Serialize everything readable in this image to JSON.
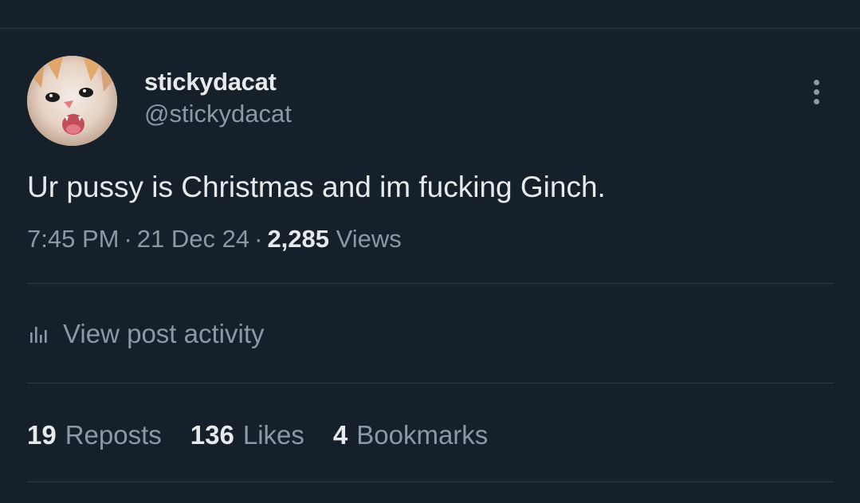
{
  "author": {
    "display_name": "stickydacat",
    "handle": "@stickydacat"
  },
  "post": {
    "text": "Ur pussy is Christmas and im fucking Ginch.",
    "time": "7:45 PM",
    "date": "21 Dec 24",
    "separator": "·",
    "views_count": "2,285",
    "views_label": "Views"
  },
  "activity": {
    "label": "View post activity",
    "icon": "bar-chart-icon"
  },
  "stats": [
    {
      "count": "19",
      "label": "Reposts"
    },
    {
      "count": "136",
      "label": "Likes"
    },
    {
      "count": "4",
      "label": "Bookmarks"
    }
  ],
  "icons": {
    "more": "more-vertical-icon",
    "avatar": "kitten-avatar"
  },
  "colors": {
    "background": "#15202b",
    "primary_text": "#e7e9ea",
    "secondary_text": "#8b98a5",
    "divider": "#2f3a46"
  }
}
